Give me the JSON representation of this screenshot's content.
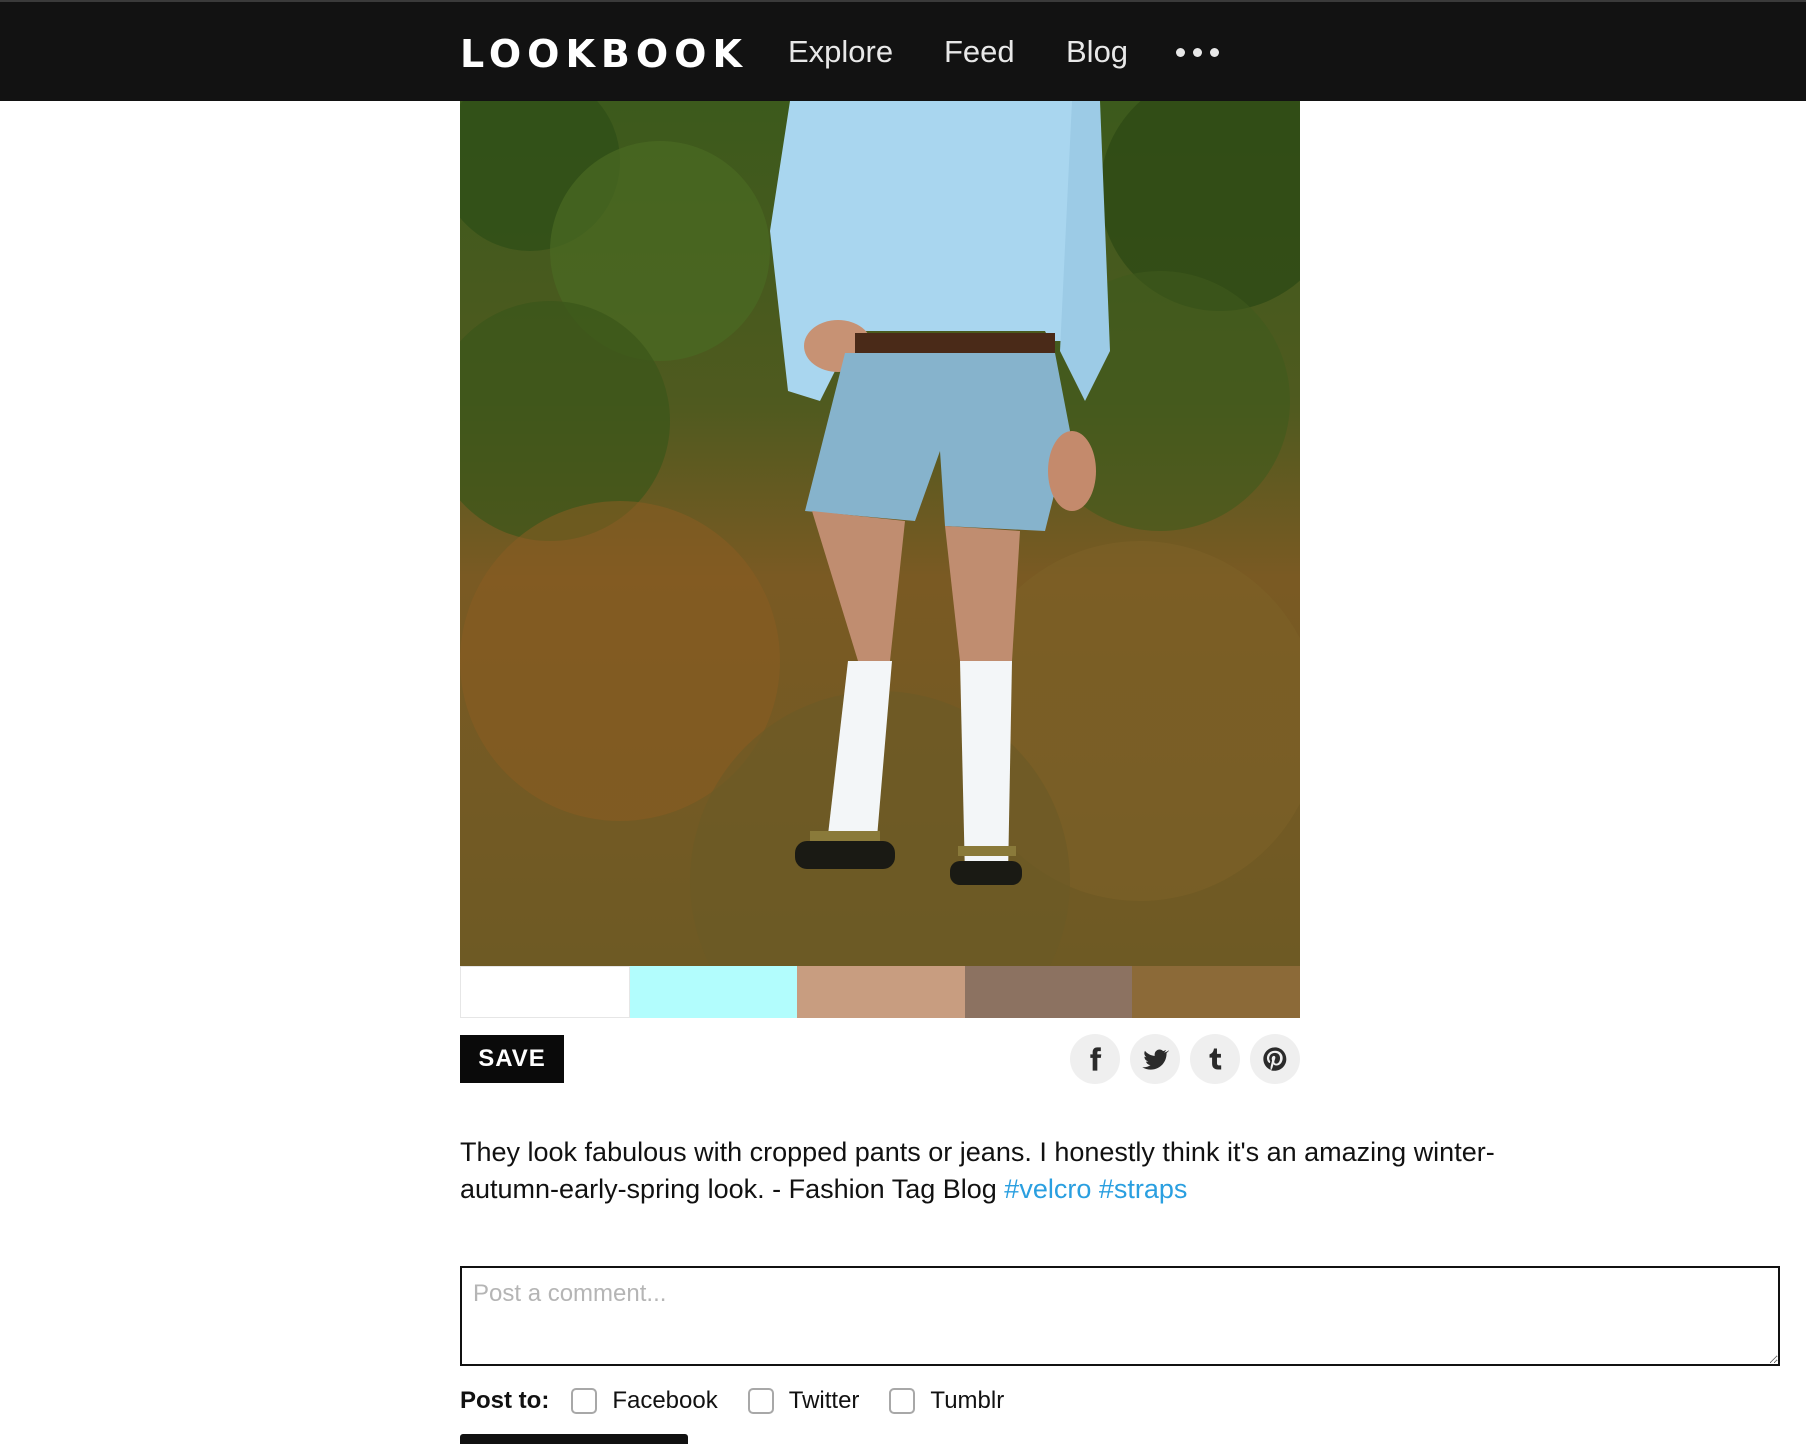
{
  "header": {
    "logo": "LOOKBOOK",
    "nav": [
      {
        "label": "Explore"
      },
      {
        "label": "Feed"
      },
      {
        "label": "Blog"
      }
    ],
    "more_icon": "more-dots-icon"
  },
  "look": {
    "photo_subject": "person in light blue long-sleeve shirt, cut-off denim shorts, white knee socks and velcro sandals standing in grass",
    "swatches": [
      "#ffffff",
      "#b2fdfd",
      "#c89d80",
      "#8c7261",
      "#8c6a38"
    ]
  },
  "actions": {
    "save_label": "SAVE",
    "share": [
      {
        "name": "facebook-icon"
      },
      {
        "name": "twitter-icon"
      },
      {
        "name": "tumblr-icon"
      },
      {
        "name": "pinterest-icon"
      }
    ]
  },
  "caption": {
    "text": "They look fabulous with cropped pants or jeans. I honestly think it's an amazing winter-autumn-early-spring look. - Fashion Tag Blog",
    "tags": [
      "#velcro",
      "#straps"
    ]
  },
  "comment": {
    "placeholder": "Post a comment...",
    "post_to_label": "Post to:",
    "options": [
      {
        "label": "Facebook",
        "checked": false
      },
      {
        "label": "Twitter",
        "checked": false
      },
      {
        "label": "Tumblr",
        "checked": false
      }
    ]
  },
  "colors": {
    "link": "#2a9fe0",
    "topbar": "#121212"
  }
}
